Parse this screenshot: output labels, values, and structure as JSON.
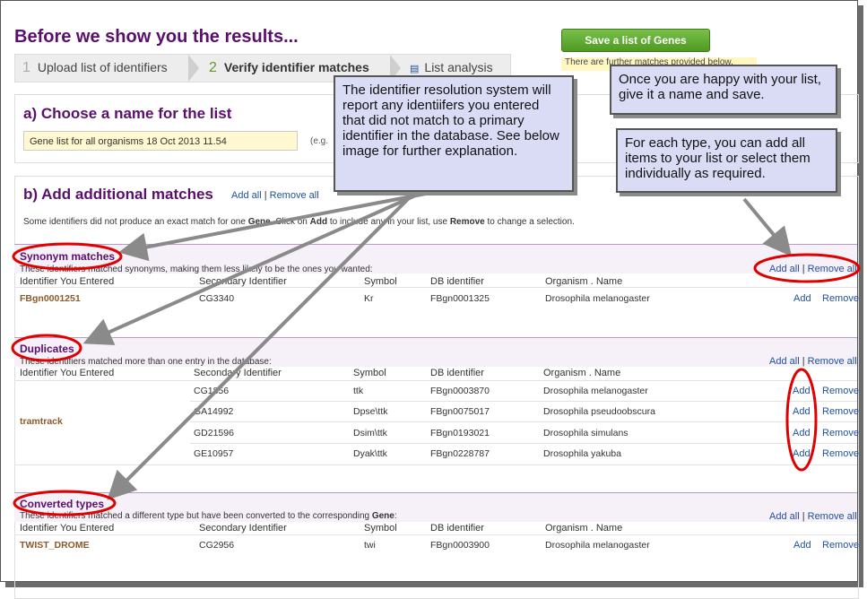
{
  "page": {
    "title": "Before we show you the results...",
    "steps": [
      {
        "num": "1",
        "label": "Upload list of identifiers"
      },
      {
        "num": "2",
        "label": "Verify identifier matches"
      },
      {
        "num": "",
        "label": "List analysis"
      }
    ],
    "save_button": "Save a list of Genes",
    "further_matches": "There are further matches provided below."
  },
  "section_a": {
    "heading": "a) Choose a name for the list",
    "list_name_value": "Gene list for all organisms 18 Oct 2013 11.54",
    "eg_text": "(e.g."
  },
  "section_b": {
    "heading": "b) Add additional matches",
    "add_all": "Add all",
    "separator": "|",
    "remove_all": "Remove all",
    "intro_pre": "Some identifiers did not produce an exact match for one ",
    "intro_gene": "Gene",
    "intro_mid": ". Click on ",
    "intro_add": "Add",
    "intro_mid2": " to include any in your list, use ",
    "intro_remove": "Remove",
    "intro_post": " to change a selection."
  },
  "columns": {
    "entered": "Identifier You Entered",
    "secondary": "Secondary Identifier",
    "symbol": "Symbol",
    "db": "DB identifier",
    "organism": "Organism . Name"
  },
  "synonyms": {
    "title": "Synonym matches",
    "desc": "These identifiers matched synonyms, making them less likely to be the ones you wanted:",
    "rows": [
      {
        "entered": "FBgn0001251",
        "secondary": "CG3340",
        "symbol": "Kr",
        "db": "FBgn0001325",
        "organism": "Drosophila melanogaster"
      }
    ]
  },
  "duplicates": {
    "title": "Duplicates",
    "desc": "These identifiers matched more than one entry in the database:",
    "entered": "tramtrack",
    "rows": [
      {
        "secondary": "CG1856",
        "symbol": "ttk",
        "db": "FBgn0003870",
        "organism": "Drosophila melanogaster"
      },
      {
        "secondary": "GA14992",
        "symbol": "Dpse\\ttk",
        "db": "FBgn0075017",
        "organism": "Drosophila pseudoobscura"
      },
      {
        "secondary": "GD21596",
        "symbol": "Dsim\\ttk",
        "db": "FBgn0193021",
        "organism": "Drosophila simulans"
      },
      {
        "secondary": "GE10957",
        "symbol": "Dyak\\ttk",
        "db": "FBgn0228787",
        "organism": "Drosophila yakuba"
      }
    ]
  },
  "converted": {
    "title": "Converted types",
    "desc_pre": "These identifiers matched a different type but have been converted to the corresponding ",
    "desc_gene": "Gene",
    "desc_post": ":",
    "rows": [
      {
        "entered": "TWIST_DROME",
        "secondary": "CG2956",
        "symbol": "twi",
        "db": "FBgn0003900",
        "organism": "Drosophila melanogaster"
      }
    ]
  },
  "row_actions": {
    "add": "Add",
    "remove": "Remove"
  },
  "callouts": {
    "resolution": "The identifier resolution system will report any identiifers you entered that did not match to a primary identifier in the database.  See below image for further explanation.",
    "save": "Once you are happy with your list, give it a name and save.",
    "add_all": "For each type, you can add all items to your list or select them individually as required."
  },
  "colors": {
    "heading": "#5b0f6d",
    "link": "#1f4f9e",
    "callout": "#dadcf6",
    "annotation_red": "#e00000",
    "arrow": "#8a8a8a",
    "button": "#5aa82c"
  }
}
